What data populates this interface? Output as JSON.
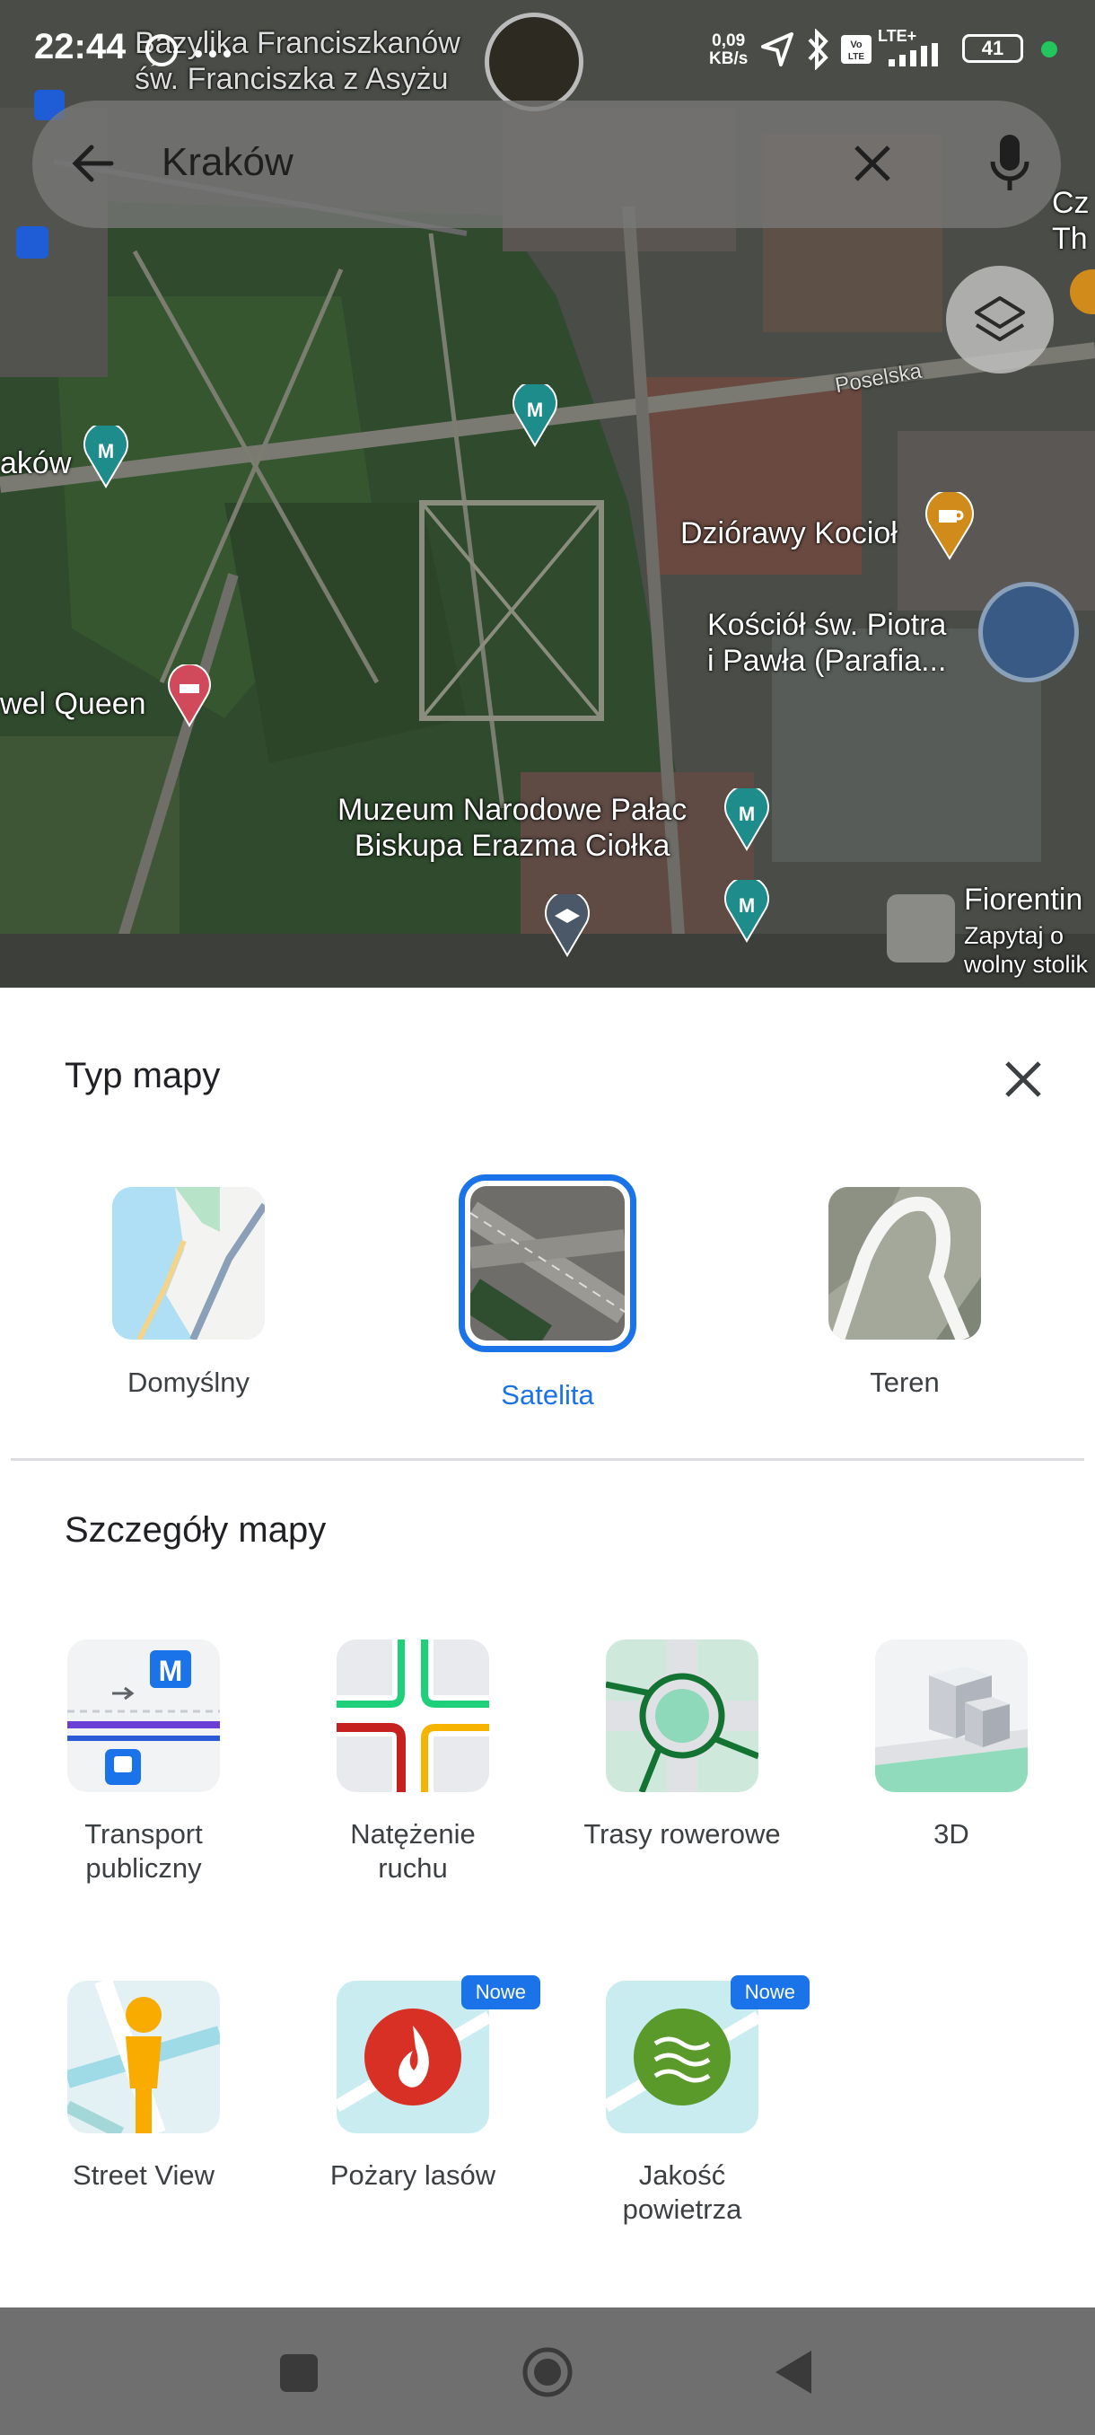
{
  "status_bar": {
    "time": "22:44",
    "net_speed_value": "0,09",
    "net_speed_unit": "KB/s",
    "battery": "41",
    "lte": "LTE+",
    "volte": "Vo LTE"
  },
  "search": {
    "query": "Kraków"
  },
  "map_labels": {
    "basilica_line1": "Bazylika Franciszkanów",
    "basilica_line2": "św. Franciszka z Asyżu",
    "poselska": "Poselska",
    "left_akow": "aków",
    "dziorawy": "Dziórawy Kocioł",
    "kosciol_line1": "Kościół św. Piotra",
    "kosciol_line2": "i Pawła (Parafia...",
    "pawel_queen": "wel Queen",
    "muzeum_line1": "Muzeum Narodowe Pałac",
    "muzeum_line2": "Biskupa Erazma Ciołka",
    "fiorentina": "Fiorentin",
    "zapytaj_line1": "Zapytaj o",
    "zapytaj_line2": "wolny stolik",
    "cz_line1": "Cz",
    "cz_line2": "Th"
  },
  "map_type": {
    "title": "Typ mapy",
    "options": [
      {
        "label": "Domyślny",
        "selected": false
      },
      {
        "label": "Satelita",
        "selected": true
      },
      {
        "label": "Teren",
        "selected": false
      }
    ]
  },
  "map_details": {
    "title": "Szczegóły mapy",
    "items": [
      {
        "label_line1": "Transport",
        "label_line2": "publiczny",
        "badge": ""
      },
      {
        "label_line1": "Natężenie",
        "label_line2": "ruchu",
        "badge": ""
      },
      {
        "label_line1": "Trasy rowerowe",
        "label_line2": "",
        "badge": ""
      },
      {
        "label_line1": "3D",
        "label_line2": "",
        "badge": ""
      },
      {
        "label_line1": "Street View",
        "label_line2": "",
        "badge": ""
      },
      {
        "label_line1": "Pożary lasów",
        "label_line2": "",
        "badge": "Nowe"
      },
      {
        "label_line1": "Jakość",
        "label_line2": "powietrza",
        "badge": "Nowe"
      }
    ]
  },
  "colors": {
    "accent": "#1a73e8",
    "metro_badge": "#1a73e8",
    "fire_red": "#d93025",
    "air_green": "#5a9a2a"
  }
}
